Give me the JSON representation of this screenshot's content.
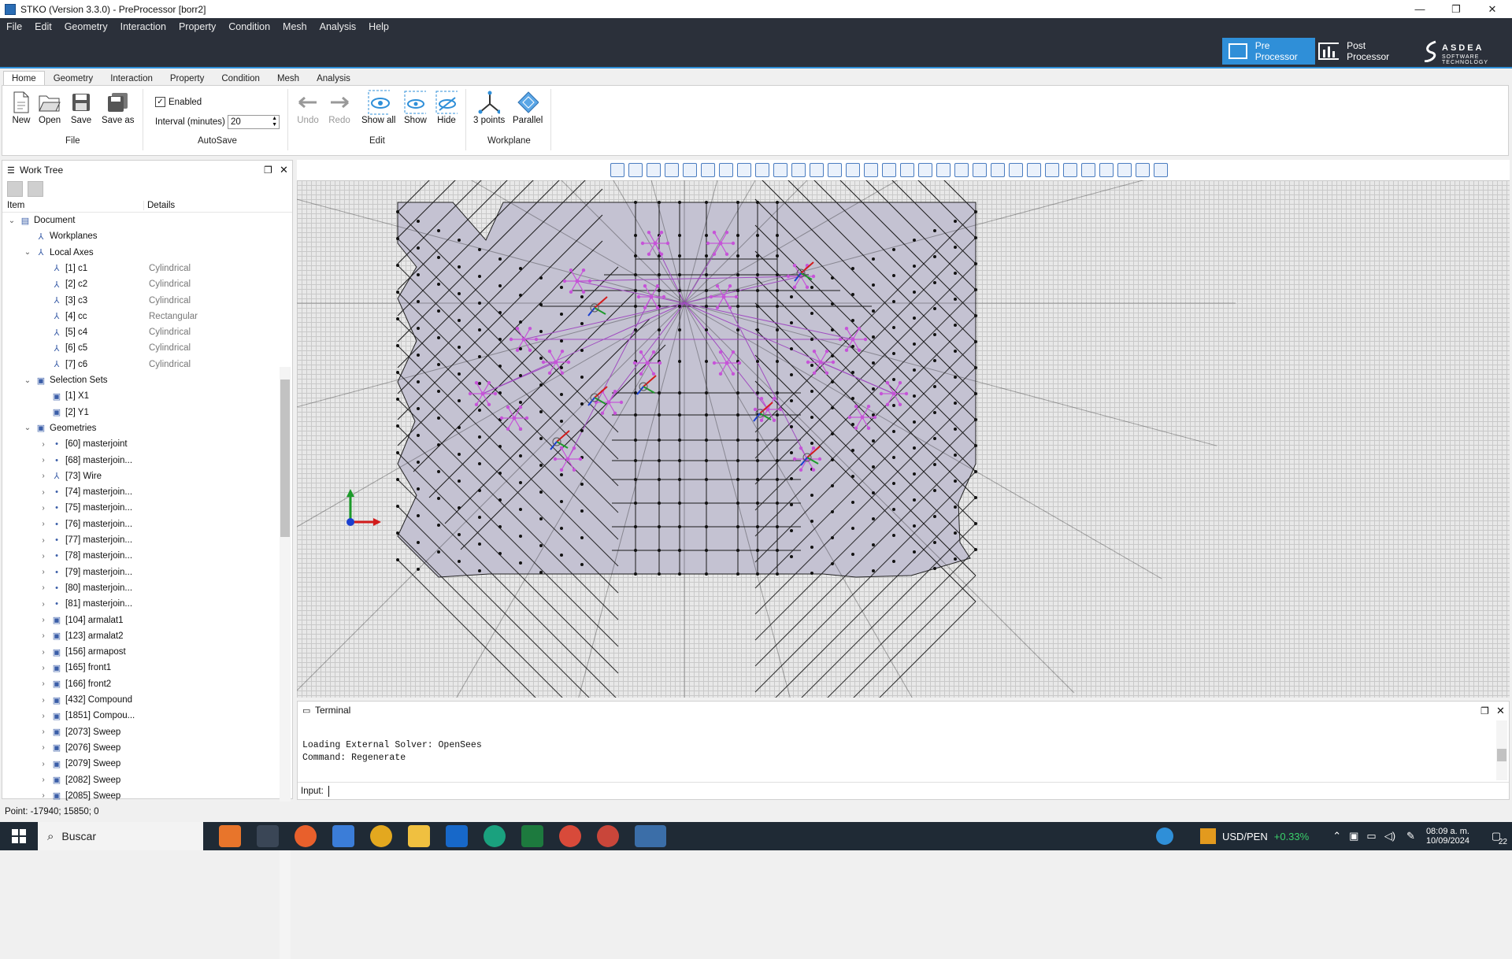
{
  "window": {
    "title": "STKO (Version 3.3.0) - PreProcessor [borr2]",
    "minimize": "—",
    "restore": "❐",
    "close": "✕"
  },
  "menu": [
    "File",
    "Edit",
    "Geometry",
    "Interaction",
    "Property",
    "Condition",
    "Mesh",
    "Analysis",
    "Help"
  ],
  "brand": {
    "pre": "Pre Processor",
    "post": "Post Processor",
    "logo_line1": "ASDEA",
    "logo_line2": "SOFTWARE TECHNOLOGY"
  },
  "tabs": [
    "Home",
    "Geometry",
    "Interaction",
    "Property",
    "Condition",
    "Mesh",
    "Analysis"
  ],
  "ribbon": {
    "file": {
      "new": "New",
      "open": "Open",
      "save": "Save",
      "save_as": "Save as",
      "group": "File"
    },
    "autosave": {
      "enabled": "Enabled",
      "interval_label": "Interval (minutes)",
      "interval_value": "20",
      "group": "AutoSave"
    },
    "edit": {
      "undo": "Undo",
      "redo": "Redo",
      "show_all": "Show all",
      "show": "Show",
      "hide": "Hide",
      "group": "Edit"
    },
    "workplane": {
      "three_points": "3 points",
      "parallel": "Parallel",
      "group": "Workplane"
    }
  },
  "worktree": {
    "title": "Work Tree",
    "col_item": "Item",
    "col_details": "Details",
    "rows": [
      {
        "label": "Document",
        "detail": "",
        "level": 0,
        "chev": "v"
      },
      {
        "label": "Workplanes",
        "detail": "",
        "level": 1,
        "chev": ""
      },
      {
        "label": "Local Axes",
        "detail": "",
        "level": 1,
        "chev": "v"
      },
      {
        "label": "[1] c1",
        "detail": "Cylindrical",
        "level": 2,
        "chev": ""
      },
      {
        "label": "[2] c2",
        "detail": "Cylindrical",
        "level": 2,
        "chev": ""
      },
      {
        "label": "[3] c3",
        "detail": "Cylindrical",
        "level": 2,
        "chev": ""
      },
      {
        "label": "[4] cc",
        "detail": "Rectangular",
        "level": 2,
        "chev": ""
      },
      {
        "label": "[5] c4",
        "detail": "Cylindrical",
        "level": 2,
        "chev": ""
      },
      {
        "label": "[6] c5",
        "detail": "Cylindrical",
        "level": 2,
        "chev": ""
      },
      {
        "label": "[7] c6",
        "detail": "Cylindrical",
        "level": 2,
        "chev": ""
      },
      {
        "label": "Selection Sets",
        "detail": "",
        "level": 1,
        "chev": "v"
      },
      {
        "label": "[1] X1",
        "detail": "",
        "level": 2,
        "chev": ""
      },
      {
        "label": "[2] Y1",
        "detail": "",
        "level": 2,
        "chev": ""
      },
      {
        "label": "Geometries",
        "detail": "",
        "level": 1,
        "chev": "v"
      },
      {
        "label": "[60] masterjoint",
        "detail": "",
        "level": 2,
        "chev": ">"
      },
      {
        "label": "[68] masterjoin...",
        "detail": "",
        "level": 2,
        "chev": ">"
      },
      {
        "label": "[73] Wire",
        "detail": "",
        "level": 2,
        "chev": ">"
      },
      {
        "label": "[74] masterjoin...",
        "detail": "",
        "level": 2,
        "chev": ">"
      },
      {
        "label": "[75] masterjoin...",
        "detail": "",
        "level": 2,
        "chev": ">"
      },
      {
        "label": "[76] masterjoin...",
        "detail": "",
        "level": 2,
        "chev": ">"
      },
      {
        "label": "[77] masterjoin...",
        "detail": "",
        "level": 2,
        "chev": ">"
      },
      {
        "label": "[78] masterjoin...",
        "detail": "",
        "level": 2,
        "chev": ">"
      },
      {
        "label": "[79] masterjoin...",
        "detail": "",
        "level": 2,
        "chev": ">"
      },
      {
        "label": "[80] masterjoin...",
        "detail": "",
        "level": 2,
        "chev": ">"
      },
      {
        "label": "[81] masterjoin...",
        "detail": "",
        "level": 2,
        "chev": ">"
      },
      {
        "label": "[104] armalat1",
        "detail": "",
        "level": 2,
        "chev": ">"
      },
      {
        "label": "[123] armalat2",
        "detail": "",
        "level": 2,
        "chev": ">"
      },
      {
        "label": "[156] armapost",
        "detail": "",
        "level": 2,
        "chev": ">"
      },
      {
        "label": "[165] front1",
        "detail": "",
        "level": 2,
        "chev": ">"
      },
      {
        "label": "[166] front2",
        "detail": "",
        "level": 2,
        "chev": ">"
      },
      {
        "label": "[432] Compound",
        "detail": "",
        "level": 2,
        "chev": ">"
      },
      {
        "label": "[1851] Compou...",
        "detail": "",
        "level": 2,
        "chev": ">"
      },
      {
        "label": "[2073] Sweep",
        "detail": "",
        "level": 2,
        "chev": ">"
      },
      {
        "label": "[2076] Sweep",
        "detail": "",
        "level": 2,
        "chev": ">"
      },
      {
        "label": "[2079] Sweep",
        "detail": "",
        "level": 2,
        "chev": ">"
      },
      {
        "label": "[2082] Sweep",
        "detail": "",
        "level": 2,
        "chev": ">"
      },
      {
        "label": "[2085] Sweep",
        "detail": "",
        "level": 2,
        "chev": ">"
      }
    ]
  },
  "terminal": {
    "title": "Terminal",
    "lines": "Loading External Solver: OpenSees\nCommand: Regenerate",
    "input_label": "Input:"
  },
  "status": {
    "point": "Point: -17940; 15850; 0"
  },
  "taskbar": {
    "search": "Buscar",
    "ticker": "USD/PEN",
    "ticker_change": "+0.33%",
    "time": "08:09 a. m.",
    "date": "10/09/2024",
    "notif": "22"
  },
  "colors": {
    "accent": "#2f8fd8",
    "menubar": "#2b303a",
    "mesh_fill": "#c4c2d2",
    "joints": "#c653d8",
    "taskbar": "#1f2a35"
  }
}
